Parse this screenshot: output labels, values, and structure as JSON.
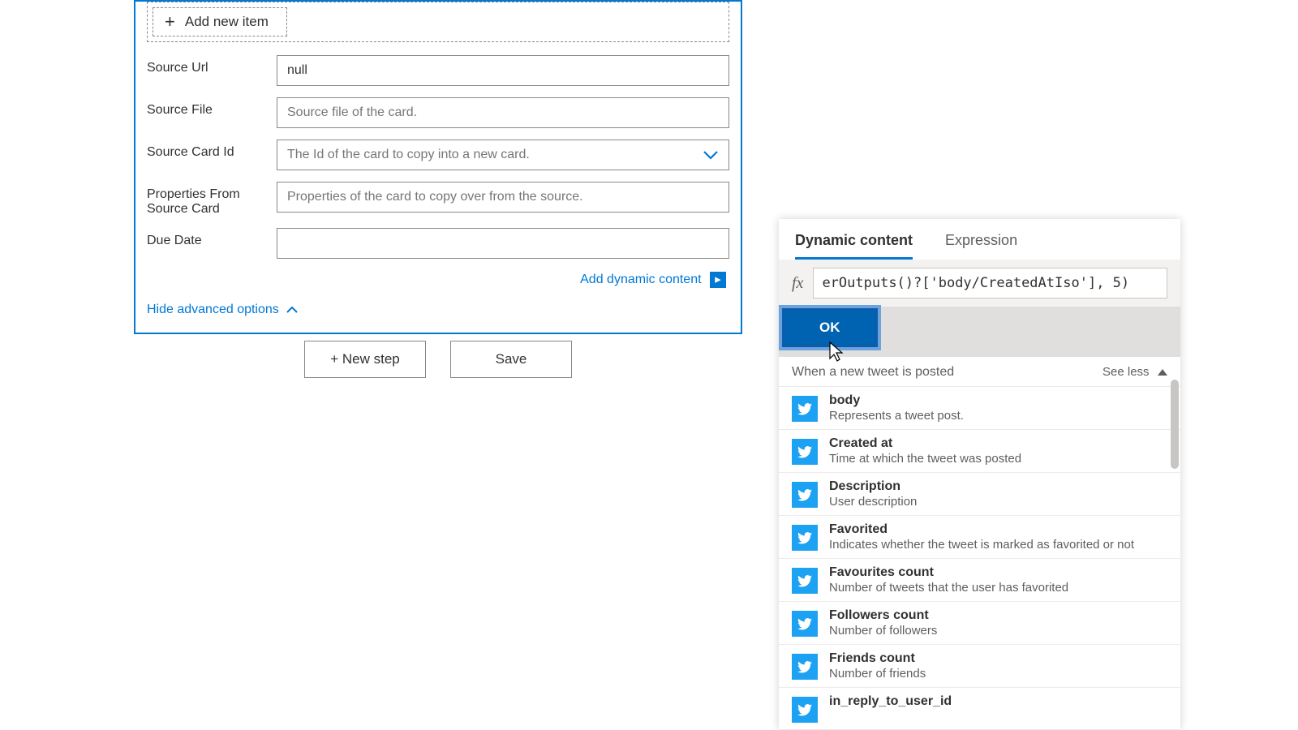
{
  "card": {
    "add_new_item": "Add new item",
    "fields": {
      "source_url": {
        "label": "Source Url",
        "value": "null"
      },
      "source_file": {
        "label": "Source File",
        "placeholder": "Source file of the card."
      },
      "source_card_id": {
        "label": "Source Card Id",
        "placeholder": "The Id of the card to copy into a new card."
      },
      "properties_from_source": {
        "label": "Properties From Source Card",
        "placeholder": "Properties of the card to copy over from the source."
      },
      "due_date": {
        "label": "Due Date",
        "value": ""
      }
    },
    "add_dynamic_content": "Add dynamic content",
    "hide_advanced": "Hide advanced options"
  },
  "buttons": {
    "new_step": "+ New step",
    "save": "Save"
  },
  "dc": {
    "tab_dynamic": "Dynamic content",
    "tab_expression": "Expression",
    "fx": "fx",
    "expression_value": "erOutputs()?['body/CreatedAtIso'], 5)",
    "ok": "OK",
    "section_title": "When a new tweet is posted",
    "see_less": "See less",
    "items": [
      {
        "title": "body",
        "desc": "Represents a tweet post."
      },
      {
        "title": "Created at",
        "desc": "Time at which the tweet was posted"
      },
      {
        "title": "Description",
        "desc": "User description"
      },
      {
        "title": "Favorited",
        "desc": "Indicates whether the tweet is marked as favorited or not"
      },
      {
        "title": "Favourites count",
        "desc": "Number of tweets that the user has favorited"
      },
      {
        "title": "Followers count",
        "desc": "Number of followers"
      },
      {
        "title": "Friends count",
        "desc": "Number of friends"
      },
      {
        "title": "in_reply_to_user_id",
        "desc": ""
      }
    ]
  }
}
